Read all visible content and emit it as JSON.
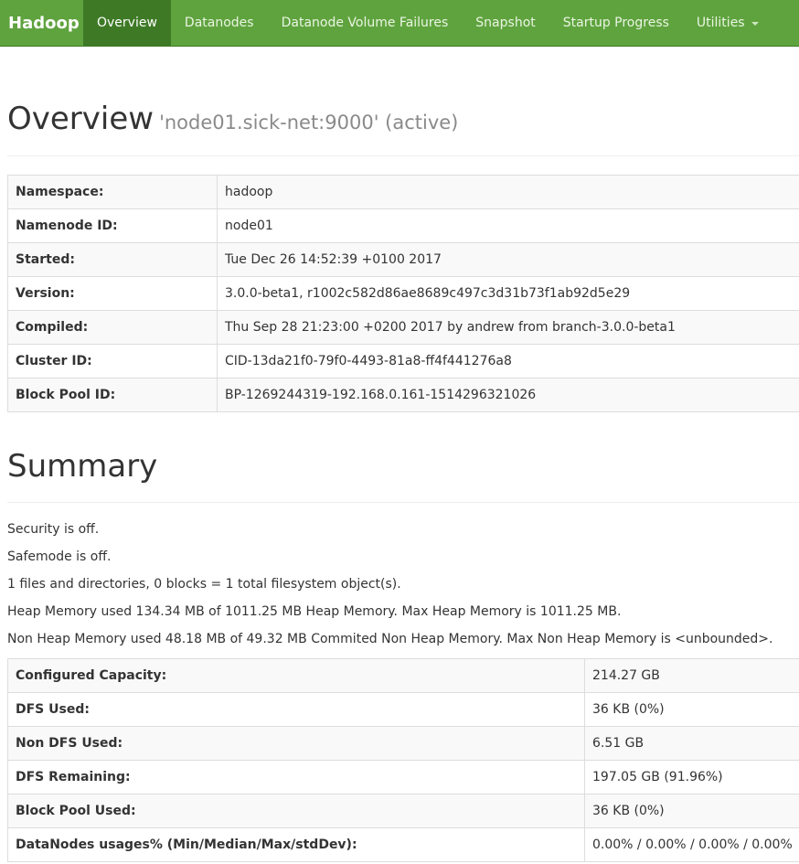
{
  "nav": {
    "brand": "Hadoop",
    "items": [
      "Overview",
      "Datanodes",
      "Datanode Volume Failures",
      "Snapshot",
      "Startup Progress",
      "Utilities"
    ]
  },
  "header": {
    "title": "Overview",
    "subtitle": "'node01.sick-net:9000' (active)"
  },
  "info_rows": [
    {
      "k": "Namespace:",
      "v": "hadoop"
    },
    {
      "k": "Namenode ID:",
      "v": "node01"
    },
    {
      "k": "Started:",
      "v": "Tue Dec 26 14:52:39 +0100 2017"
    },
    {
      "k": "Version:",
      "v": "3.0.0-beta1, r1002c582d86ae8689c497c3d31b73f1ab92d5e29"
    },
    {
      "k": "Compiled:",
      "v": "Thu Sep 28 21:23:00 +0200 2017 by andrew from branch-3.0.0-beta1"
    },
    {
      "k": "Cluster ID:",
      "v": "CID-13da21f0-79f0-4493-81a8-ff4f441276a8"
    },
    {
      "k": "Block Pool ID:",
      "v": "BP-1269244319-192.168.0.161-1514296321026"
    }
  ],
  "summary": {
    "title": "Summary",
    "lines": [
      "Security is off.",
      "Safemode is off.",
      "1 files and directories, 0 blocks = 1 total filesystem object(s).",
      "Heap Memory used 134.34 MB of 1011.25 MB Heap Memory. Max Heap Memory is 1011.25 MB.",
      "Non Heap Memory used 48.18 MB of 49.32 MB Commited Non Heap Memory. Max Non Heap Memory is <unbounded>."
    ],
    "rows": [
      {
        "k": "Configured Capacity:",
        "v": "214.27 GB"
      },
      {
        "k": "DFS Used:",
        "v": "36 KB (0%)"
      },
      {
        "k": "Non DFS Used:",
        "v": "6.51 GB"
      },
      {
        "k": "DFS Remaining:",
        "v": "197.05 GB (91.96%)"
      },
      {
        "k": "Block Pool Used:",
        "v": "36 KB (0%)"
      },
      {
        "k": "DataNodes usages% (Min/Median/Max/stdDev):",
        "v": "0.00% / 0.00% / 0.00% / 0.00%"
      }
    ]
  }
}
